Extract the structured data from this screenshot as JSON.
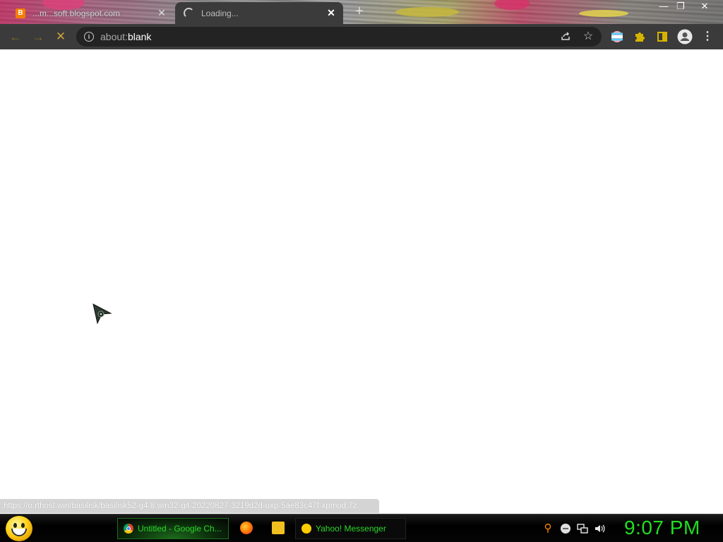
{
  "browser": {
    "tabs": [
      {
        "title": "...m...soft.blogspot.com",
        "favicon": "blogger-icon",
        "active": false
      },
      {
        "title": "Loading...",
        "favicon": "loading-spinner",
        "active": true
      }
    ],
    "address_bar": {
      "scheme_text": "about:",
      "host_text": "blank"
    },
    "status_url": "https://o.rthost.win/basilisk/basilisk52-g4.8.win32-git-20220827-3219d2d-uxp-5ae83c47f-xpmod.7z"
  },
  "taskbar": {
    "start_icon": "yahoo-smiley-icon",
    "buttons": [
      {
        "label": "Untitled - Google Ch...",
        "icon": "chrome-icon",
        "active": true
      },
      {
        "label": "Yahoo! Messenger",
        "icon": "yahoo-messenger-icon",
        "active": false
      }
    ],
    "quick_launch": [
      "firefox-icon",
      "folder-icon"
    ],
    "tray_icons": [
      "search-icon",
      "messenger-status-icon",
      "network-icon",
      "volume-icon"
    ],
    "clock": "9:07 PM"
  },
  "colors": {
    "toolbar_bg": "#3b3b3b",
    "omnibox_bg": "#232323",
    "taskbar_text": "#2bd62b",
    "clock": "#22dd22",
    "extension_accent": "#d4b400"
  }
}
